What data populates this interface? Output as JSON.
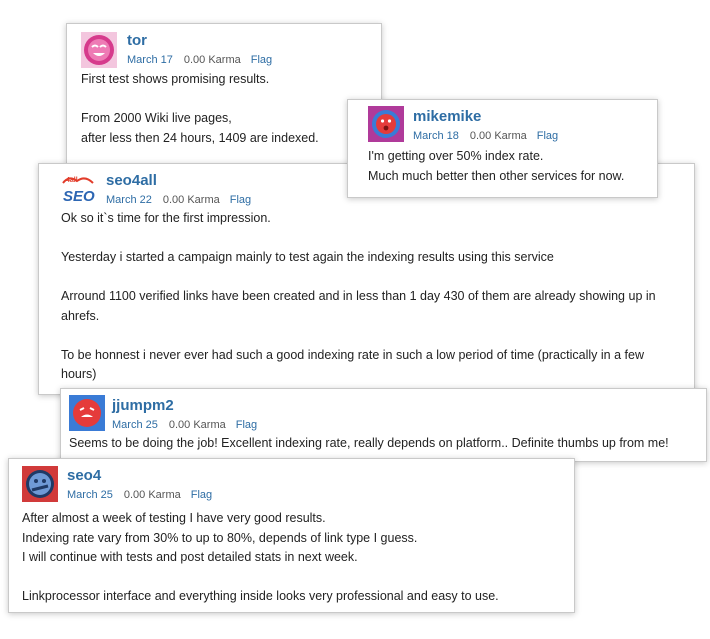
{
  "comments": [
    {
      "username": "tor",
      "date": "March 17",
      "karma": "0.00 Karma",
      "flag": "Flag",
      "lines": [
        "First test shows promising results.",
        "",
        "From 2000 Wiki live pages,",
        "after less then 24 hours, 1409 are indexed."
      ],
      "avatar_color": "#d63a8c"
    },
    {
      "username": "mikemike",
      "date": "March 18",
      "karma": "0.00 Karma",
      "flag": "Flag",
      "lines": [
        "I'm getting over 50% index rate.",
        "Much much better then other services for now."
      ],
      "avatar_color": "#8a2a8e"
    },
    {
      "username": "seo4all",
      "date": "March 22",
      "karma": "0.00 Karma",
      "flag": "Flag",
      "lines": [
        "Ok so it`s time for the first impression.",
        "",
        "Yesterday i started a campaign mainly to test again the indexing results using this service",
        "",
        "Arround 1100 verified links have been created and in less than 1 day 430 of them are already showing up in",
        "ahrefs.",
        "",
        "To be honnest i never ever had such a good indexing rate in such a low period of time (practically in a few",
        "hours)"
      ],
      "avatar_color": "#3a6db3"
    },
    {
      "username": "jjumpm2",
      "date": "March 25",
      "karma": "0.00 Karma",
      "flag": "Flag",
      "lines": [
        "Seems to be doing the job! Excellent indexing rate, really depends on platform.. Definite thumbs up from me!"
      ],
      "avatar_color": "#2f6fc2"
    },
    {
      "username": "seo4",
      "date": "March 25",
      "karma": "0.00 Karma",
      "flag": "Flag",
      "lines": [
        "After almost a week of testing I have very good results.",
        "Indexing rate vary from 30% to up to 80%, depends of link type I guess.",
        "I will continue with tests and post detailed stats in next week.",
        "",
        "Linkprocessor interface and everything inside looks very professional and easy to use."
      ],
      "avatar_color": "#d13a3a"
    }
  ],
  "link_color": "#2e6da4"
}
